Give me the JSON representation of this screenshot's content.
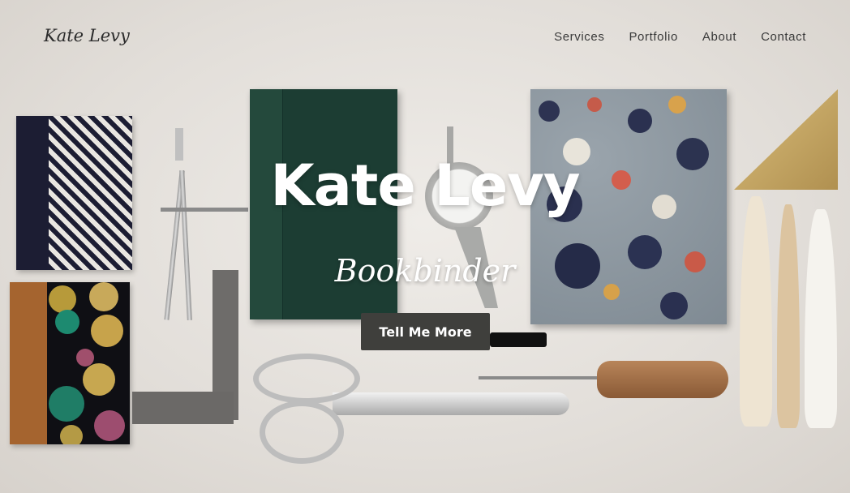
{
  "brand": {
    "name": "Kate Levy"
  },
  "nav": {
    "items": [
      "Services",
      "Portfolio",
      "About",
      "Contact"
    ]
  },
  "hero": {
    "title": "Kate Levy",
    "subtitle": "Bookbinder",
    "cta_label": "Tell Me More"
  },
  "colors": {
    "background": "#e4e0dc",
    "text_dark": "#2b2b2b",
    "cta_background": "#3f3f3c",
    "hero_text": "#ffffff"
  }
}
